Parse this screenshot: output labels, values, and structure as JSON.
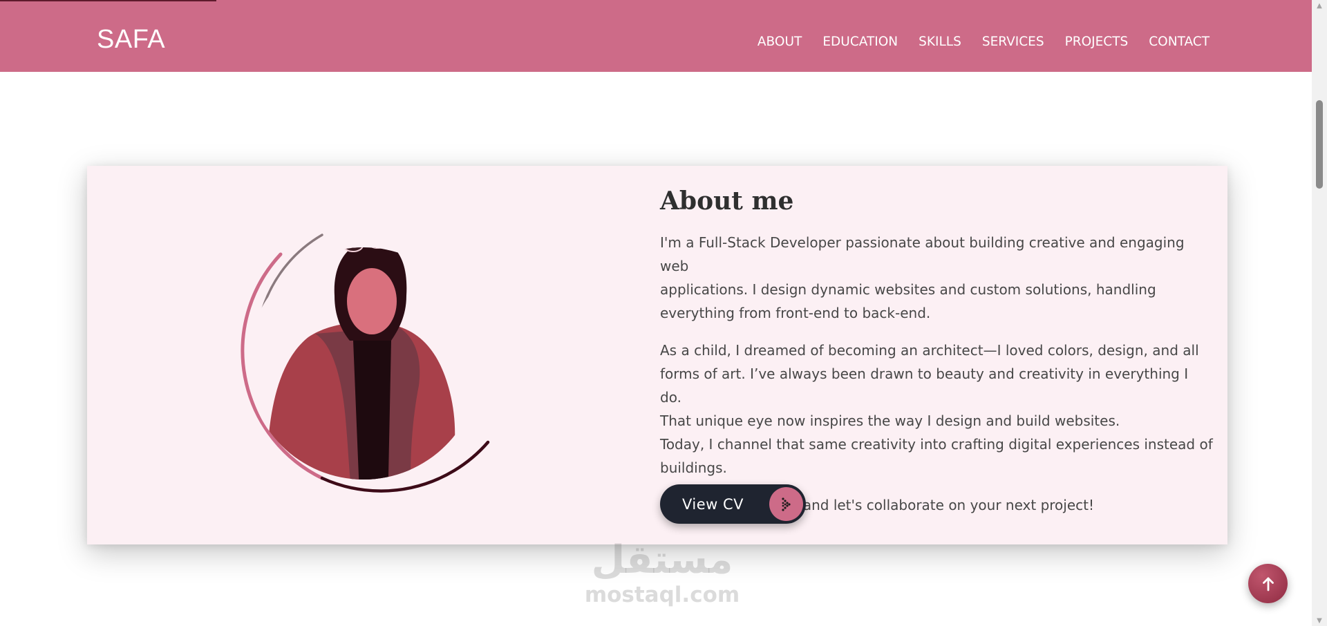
{
  "progress": {
    "percent": 16.5
  },
  "header": {
    "brand": "SAFA",
    "nav": [
      "ABOUT",
      "EDUCATION",
      "SKILLS",
      "SERVICES",
      "PROJECTS",
      "CONTACT"
    ]
  },
  "about": {
    "title": "About me",
    "p1": [
      "I'm a Full-Stack Developer passionate about building creative and engaging web",
      "applications. I design dynamic websites and custom solutions, handling",
      "everything from front-end to back-end."
    ],
    "p2": [
      "As a child, I dreamed of becoming an architect—I loved colors, design, and all",
      "forms of art. I’ve always been drawn to beauty and creativity in everything I do.",
      "That unique eye now inspires the way I design and build websites.",
      "Today, I channel that same creativity into crafting digital experiences instead of",
      "buildings."
    ],
    "p3": "Browse my portfolio and let's collaborate on your next project!",
    "cv_button": "View CV"
  },
  "watermark": {
    "arabic": "مستقل",
    "latin": "mostaql.com"
  },
  "colors": {
    "nav_bg": "#cd6b88",
    "card_bg": "#fcf0f4",
    "button_bg": "#1f2430",
    "accent": "#cd6b88",
    "dark_accent": "#5e1a2c"
  },
  "icons": {
    "cv": "double-chevron-right-icon",
    "back_to_top": "arrow-up-icon"
  }
}
